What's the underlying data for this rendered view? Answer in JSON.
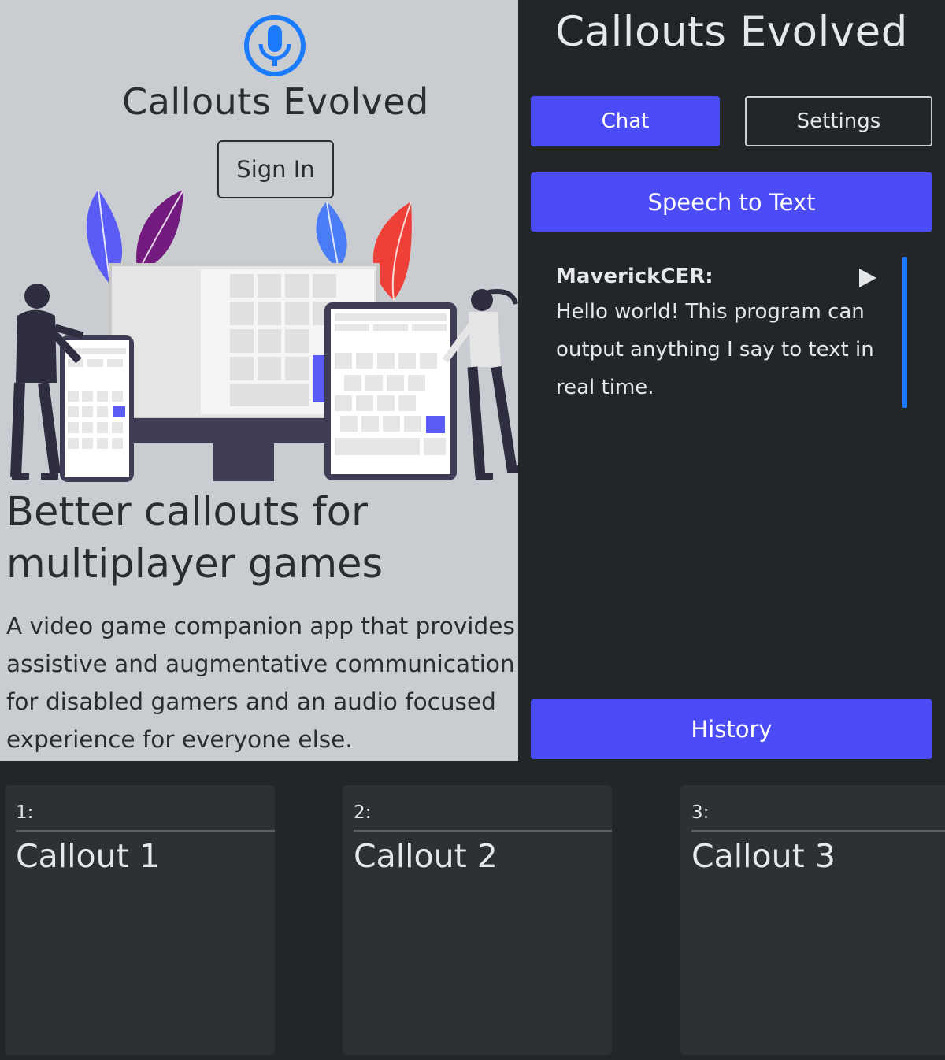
{
  "landing": {
    "brand_title": "Callouts Evolved",
    "sign_in_label": "Sign In",
    "headline": "Better callouts for multiplayer games",
    "description": "A video game companion app that provides assistive and augmentative communication for disabled gamers and an audio focused experience for everyone else.",
    "logo_icon": "microphone-icon",
    "colors": {
      "background": "#c9ccd1",
      "logo": "#1a7bff"
    }
  },
  "app": {
    "title": "Callouts Evolved",
    "tabs": [
      {
        "label": "Chat",
        "active": true
      },
      {
        "label": "Settings",
        "active": false
      }
    ],
    "speech_to_text_label": "Speech to Text",
    "message": {
      "user": "MaverickCER:",
      "text": "Hello world! This program can output anything I say to text in real time.",
      "play_icon": "play-icon"
    },
    "history_label": "History",
    "colors": {
      "accent": "#4c4cf7",
      "background": "#232629",
      "scroll_indicator": "#1a7bff"
    }
  },
  "callouts": [
    {
      "number": "1:",
      "label": "Callout 1"
    },
    {
      "number": "2:",
      "label": "Callout 2"
    },
    {
      "number": "3:",
      "label": "Callout 3"
    }
  ]
}
